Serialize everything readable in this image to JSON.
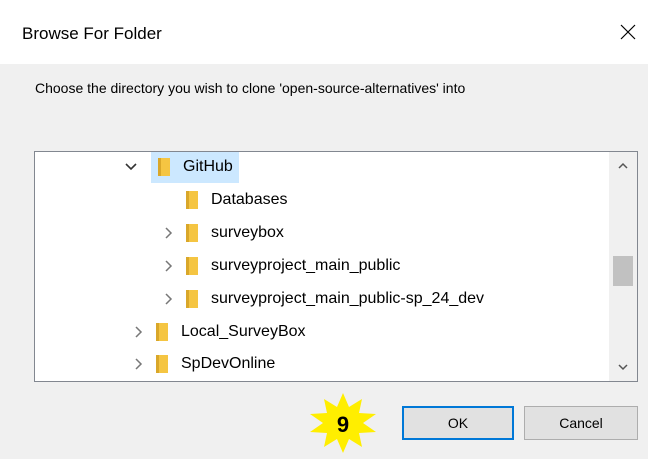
{
  "dialog": {
    "title": "Browse For Folder",
    "prompt": "Choose the directory you wish to clone 'open-source-alternatives' into"
  },
  "tree": {
    "items": [
      {
        "label": "GitHub",
        "expanded": true,
        "selected": true
      },
      {
        "label": "Databases",
        "expanded": null,
        "selected": false
      },
      {
        "label": "surveybox",
        "expanded": false,
        "selected": false
      },
      {
        "label": "surveyproject_main_public",
        "expanded": false,
        "selected": false
      },
      {
        "label": "surveyproject_main_public-sp_24_dev",
        "expanded": false,
        "selected": false
      },
      {
        "label": "Local_SurveyBox",
        "expanded": false,
        "selected": false
      },
      {
        "label": "SpDevOnline",
        "expanded": false,
        "selected": false
      }
    ],
    "scroll_position": 0.45
  },
  "buttons": {
    "ok": "OK",
    "cancel": "Cancel"
  },
  "annotation": {
    "step_number": "9",
    "color": "#ffee00"
  },
  "colors": {
    "selection": "#cce8ff",
    "folder": "#f5c542",
    "focus_border": "#0078d7"
  }
}
